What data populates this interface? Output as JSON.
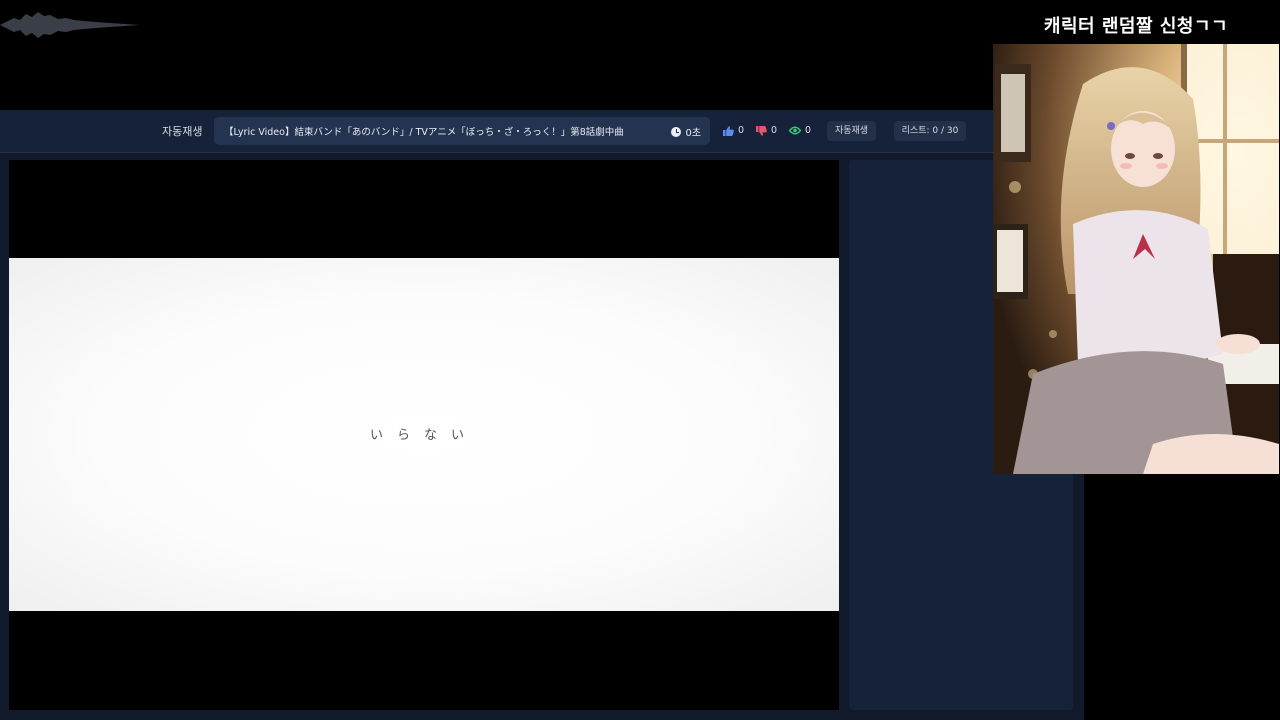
{
  "overlay": {
    "title": "캐릭터 랜덤짤 신청ㄱㄱ"
  },
  "topbar": {
    "autoplay_label": "자동재생",
    "video_title": "【Lyric Video】結束バンド「あのバンド」/ TVアニメ「ぼっち・ざ・ろっく！」第8話劇中曲",
    "duration": "0초",
    "likes": "0",
    "dislikes": "0",
    "views": "0",
    "autoplay_button": "자동재생",
    "list_status": "리스트: 0 / 30"
  },
  "player": {
    "lyric": "いらない"
  },
  "colors": {
    "like": "#5a8dee",
    "dislike": "#e05a6a",
    "views": "#3fc77a",
    "panel": "#16223a"
  },
  "icons": {
    "like": "thumbs-up-icon",
    "dislike": "thumbs-down-icon",
    "views": "eye-icon",
    "duration": "clock-icon"
  }
}
